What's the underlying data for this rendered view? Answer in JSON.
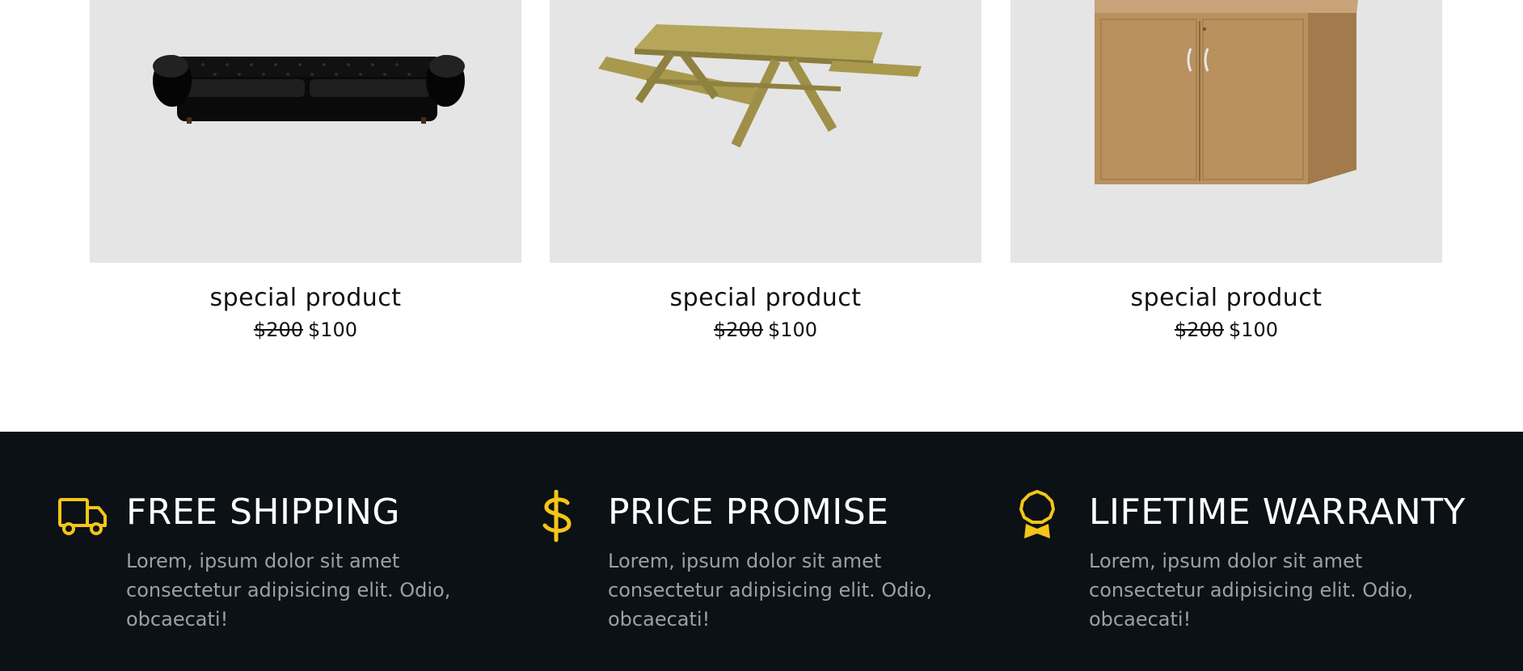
{
  "colors": {
    "card_background": "#e5e5e5",
    "footer_background": "#0b1114",
    "accent": "#f5c518",
    "feature_text": "#9aa0a4"
  },
  "products": [
    {
      "title": "special product",
      "old_price": "$200",
      "new_price": "$100",
      "image": "black-leather-sofa"
    },
    {
      "title": "special product",
      "old_price": "$200",
      "new_price": "$100",
      "image": "wooden-picnic-table"
    },
    {
      "title": "special product",
      "old_price": "$200",
      "new_price": "$100",
      "image": "wooden-cabinet"
    }
  ],
  "features": [
    {
      "icon": "truck-icon",
      "heading": "FREE SHIPPING",
      "text": "Lorem, ipsum dolor sit amet consectetur adipisicing elit. Odio, obcaecati!"
    },
    {
      "icon": "dollar-icon",
      "heading": "PRICE PROMISE",
      "text": "Lorem, ipsum dolor sit amet consectetur adipisicing elit. Odio, obcaecati!"
    },
    {
      "icon": "award-icon",
      "heading": "LIFETIME WARRANTY",
      "text": "Lorem, ipsum dolor sit amet consectetur adipisicing elit. Odio, obcaecati!"
    }
  ]
}
